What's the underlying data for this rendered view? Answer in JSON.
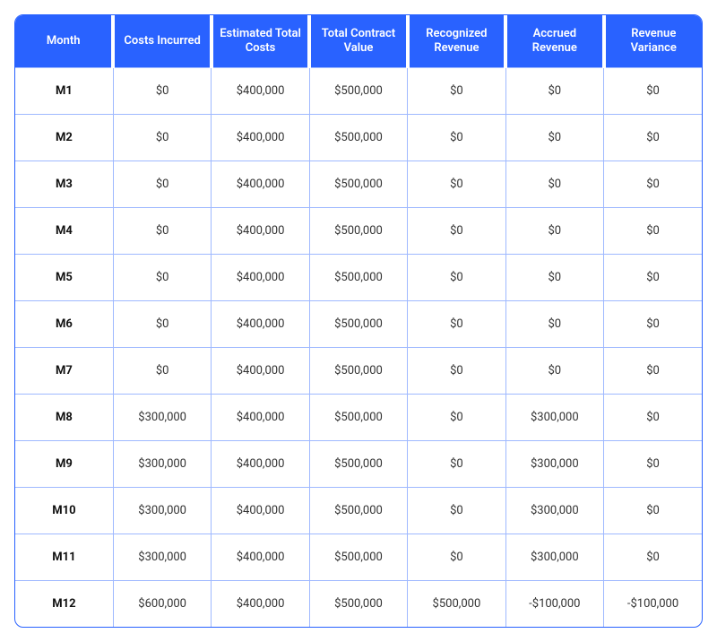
{
  "table": {
    "headers": [
      "Month",
      "Costs Incurred",
      "Estimated Total Costs",
      "Total Contract Value",
      "Recognized Revenue",
      "Accrued Revenue",
      "Revenue Variance"
    ],
    "rows": [
      {
        "month": "M1",
        "costs_incurred": "$0",
        "estimated_total_costs": "$400,000",
        "total_contract_value": "$500,000",
        "recognized_revenue": "$0",
        "accrued_revenue": "$0",
        "revenue_variance": "$0"
      },
      {
        "month": "M2",
        "costs_incurred": "$0",
        "estimated_total_costs": "$400,000",
        "total_contract_value": "$500,000",
        "recognized_revenue": "$0",
        "accrued_revenue": "$0",
        "revenue_variance": "$0"
      },
      {
        "month": "M3",
        "costs_incurred": "$0",
        "estimated_total_costs": "$400,000",
        "total_contract_value": "$500,000",
        "recognized_revenue": "$0",
        "accrued_revenue": "$0",
        "revenue_variance": "$0"
      },
      {
        "month": "M4",
        "costs_incurred": "$0",
        "estimated_total_costs": "$400,000",
        "total_contract_value": "$500,000",
        "recognized_revenue": "$0",
        "accrued_revenue": "$0",
        "revenue_variance": "$0"
      },
      {
        "month": "M5",
        "costs_incurred": "$0",
        "estimated_total_costs": "$400,000",
        "total_contract_value": "$500,000",
        "recognized_revenue": "$0",
        "accrued_revenue": "$0",
        "revenue_variance": "$0"
      },
      {
        "month": "M6",
        "costs_incurred": "$0",
        "estimated_total_costs": "$400,000",
        "total_contract_value": "$500,000",
        "recognized_revenue": "$0",
        "accrued_revenue": "$0",
        "revenue_variance": "$0"
      },
      {
        "month": "M7",
        "costs_incurred": "$0",
        "estimated_total_costs": "$400,000",
        "total_contract_value": "$500,000",
        "recognized_revenue": "$0",
        "accrued_revenue": "$0",
        "revenue_variance": "$0"
      },
      {
        "month": "M8",
        "costs_incurred": "$300,000",
        "estimated_total_costs": "$400,000",
        "total_contract_value": "$500,000",
        "recognized_revenue": "$0",
        "accrued_revenue": "$300,000",
        "revenue_variance": "$0"
      },
      {
        "month": "M9",
        "costs_incurred": "$300,000",
        "estimated_total_costs": "$400,000",
        "total_contract_value": "$500,000",
        "recognized_revenue": "$0",
        "accrued_revenue": "$300,000",
        "revenue_variance": "$0"
      },
      {
        "month": "M10",
        "costs_incurred": "$300,000",
        "estimated_total_costs": "$400,000",
        "total_contract_value": "$500,000",
        "recognized_revenue": "$0",
        "accrued_revenue": "$300,000",
        "revenue_variance": "$0"
      },
      {
        "month": "M11",
        "costs_incurred": "$300,000",
        "estimated_total_costs": "$400,000",
        "total_contract_value": "$500,000",
        "recognized_revenue": "$0",
        "accrued_revenue": "$300,000",
        "revenue_variance": "$0"
      },
      {
        "month": "M12",
        "costs_incurred": "$600,000",
        "estimated_total_costs": "$400,000",
        "total_contract_value": "$500,000",
        "recognized_revenue": "$500,000",
        "accrued_revenue": "-$100,000",
        "revenue_variance": "-$100,000"
      }
    ]
  }
}
